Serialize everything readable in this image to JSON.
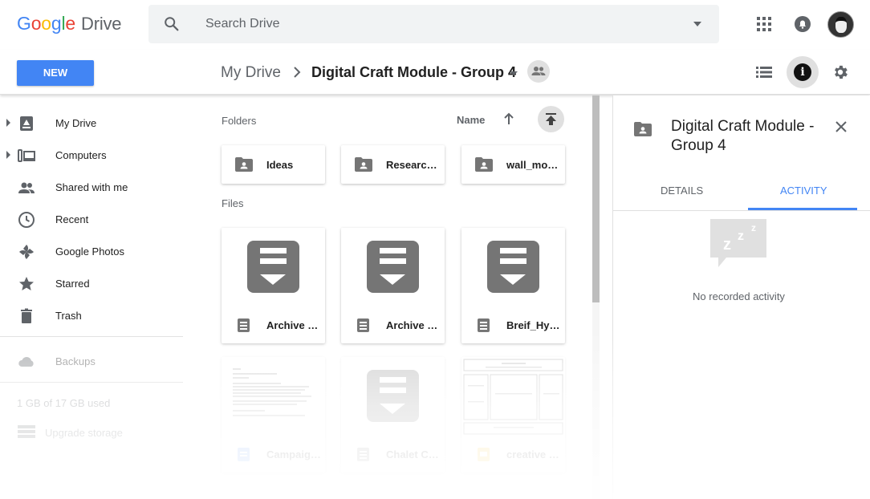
{
  "header": {
    "logo_google": [
      "G",
      "o",
      "o",
      "g",
      "l",
      "e"
    ],
    "logo_product": "Drive",
    "search_placeholder": "Search Drive"
  },
  "toolbar": {
    "new_label": "NEW",
    "breadcrumb_root": "My Drive",
    "breadcrumb_current": "Digital Craft Module - Group 4"
  },
  "sidebar": {
    "items": [
      {
        "label": "My Drive",
        "icon": "drive-icon"
      },
      {
        "label": "Computers",
        "icon": "computers-icon"
      },
      {
        "label": "Shared with me",
        "icon": "people-icon"
      },
      {
        "label": "Recent",
        "icon": "clock-icon"
      },
      {
        "label": "Google Photos",
        "icon": "photos-icon"
      },
      {
        "label": "Starred",
        "icon": "star-icon"
      },
      {
        "label": "Trash",
        "icon": "trash-icon"
      }
    ],
    "backups_label": "Backups",
    "storage_text": "1 GB of 17 GB used",
    "upgrade_label": "Upgrade storage"
  },
  "main": {
    "folders_heading": "Folders",
    "files_heading": "Files",
    "sort_label": "Name",
    "folders": [
      {
        "name": "Ideas"
      },
      {
        "name": "Researc…"
      },
      {
        "name": "wall_mo…"
      }
    ],
    "files": [
      {
        "name": "Archive …"
      },
      {
        "name": "Archive …"
      },
      {
        "name": "Breif_Hy…"
      },
      {
        "name": "Campaig…"
      },
      {
        "name": "Chalet C…"
      },
      {
        "name": "creative …"
      }
    ]
  },
  "details": {
    "title": "Digital Craft Module - Group 4",
    "tab_details": "DETAILS",
    "tab_activity": "ACTIVITY",
    "empty_text": "No recorded activity"
  },
  "colors": {
    "accent": "#4285f4",
    "icon_gray": "#757575"
  }
}
